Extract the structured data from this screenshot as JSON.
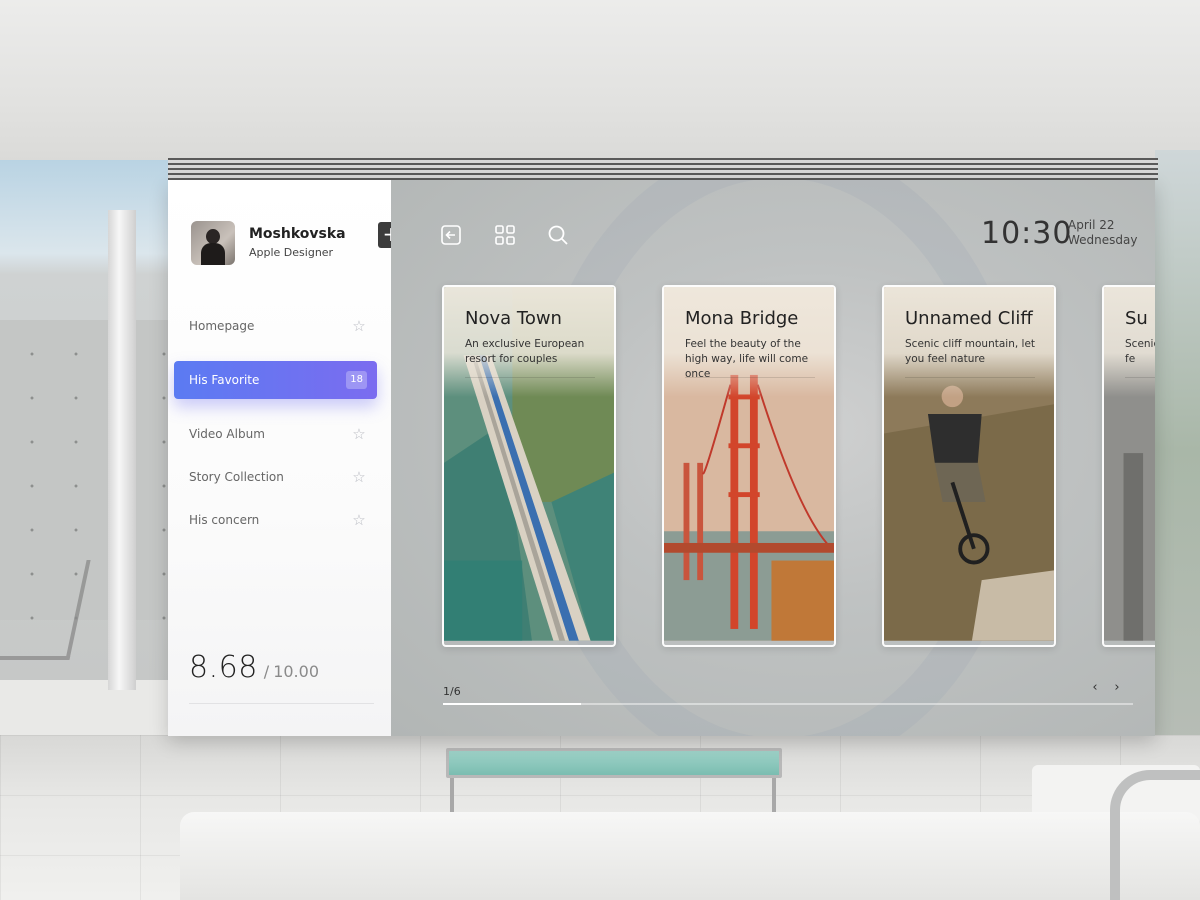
{
  "profile": {
    "name": "Moshkovska",
    "role": "Apple Designer"
  },
  "nav": [
    {
      "label": "Homepage",
      "icon": "star-icon",
      "active": false
    },
    {
      "label": "His Favorite",
      "badge": "18",
      "active": true
    },
    {
      "label": "Video Album",
      "icon": "star-icon",
      "active": false
    },
    {
      "label": "Story Collection",
      "icon": "star-icon",
      "active": false
    },
    {
      "label": "His concern",
      "icon": "star-icon",
      "active": false
    }
  ],
  "score": {
    "value": "8.68",
    "separator": "/",
    "total": "10.00"
  },
  "toolbar": {
    "add": "+",
    "icons": [
      "back-icon",
      "grid-icon",
      "search-icon"
    ]
  },
  "clock": {
    "time": "10:30",
    "date": "April 22",
    "weekday": "Wednesday"
  },
  "cards": [
    {
      "title": "Nova Town",
      "desc": "An exclusive European resort for couples",
      "scene": "aerial bridge over river"
    },
    {
      "title": "Mona Bridge",
      "desc": "Feel the beauty of the high way, life will come once",
      "scene": "golden gate bridge"
    },
    {
      "title": "Unnamed Cliff",
      "desc": "Scenic cliff mountain, let you feel nature",
      "scene": "mountain biker"
    },
    {
      "title": "Su",
      "desc": "Scenic you fe",
      "scene": "partial card"
    }
  ],
  "pager": {
    "label": "1/6",
    "progress": 0.2
  },
  "colors": {
    "accent_start": "#5b7bf2",
    "accent_end": "#7b6cf0",
    "text": "#222222"
  }
}
